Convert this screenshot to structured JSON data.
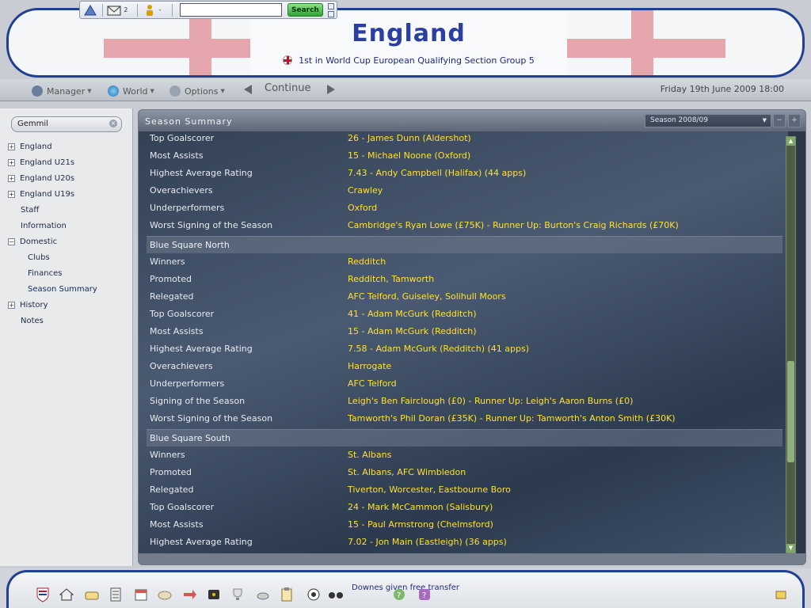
{
  "toolbar": {
    "mail_count": "2",
    "people_count": "-",
    "search_placeholder": "",
    "search_button": "Search"
  },
  "header": {
    "team_name": "England",
    "subtitle": "1st in World Cup European Qualifying Section Group 5"
  },
  "nav": {
    "manager": "Manager",
    "world": "World",
    "options": "Options",
    "continue": "Continue",
    "date": "Friday 19th June 2009 18:00"
  },
  "sidebar": {
    "search_value": "Gemmil",
    "items": [
      {
        "label": "England",
        "toggle": "+"
      },
      {
        "label": "England U21s",
        "toggle": "+"
      },
      {
        "label": "England U20s",
        "toggle": "+"
      },
      {
        "label": "England U19s",
        "toggle": "+"
      },
      {
        "label": "Staff",
        "toggle": ""
      },
      {
        "label": "Information",
        "toggle": ""
      },
      {
        "label": "Domestic",
        "toggle": "−"
      },
      {
        "label": "Clubs",
        "toggle": ""
      },
      {
        "label": "Finances",
        "toggle": ""
      },
      {
        "label": "Season Summary",
        "toggle": ""
      },
      {
        "label": "History",
        "toggle": "+"
      },
      {
        "label": "Notes",
        "toggle": ""
      }
    ]
  },
  "panel": {
    "title": "Season Summary",
    "season": "Season 2008/09",
    "sections": [
      {
        "title": "",
        "rows": [
          {
            "label": "Top Goalscorer",
            "value": "26 - James Dunn (Aldershot)"
          },
          {
            "label": "Most Assists",
            "value": "15 - Michael Noone (Oxford)"
          },
          {
            "label": "Highest Average Rating",
            "value": "7.43 - Andy Campbell (Halifax) (44 apps)"
          },
          {
            "label": "Overachievers",
            "value": "Crawley"
          },
          {
            "label": "Underperformers",
            "value": "Oxford"
          },
          {
            "label": "Worst Signing of the Season",
            "value": "Cambridge's Ryan Lowe (£75K) - Runner Up: Burton's Craig Richards (£70K)"
          }
        ]
      },
      {
        "title": "Blue Square North",
        "rows": [
          {
            "label": "Winners",
            "value": "Redditch"
          },
          {
            "label": "Promoted",
            "value": "Redditch, Tamworth"
          },
          {
            "label": "Relegated",
            "value": "AFC Telford, Guiseley, Solihull Moors"
          },
          {
            "label": "Top Goalscorer",
            "value": "41 - Adam McGurk (Redditch)"
          },
          {
            "label": "Most Assists",
            "value": "15 - Adam McGurk (Redditch)"
          },
          {
            "label": "Highest Average Rating",
            "value": "7.58 - Adam McGurk (Redditch) (41 apps)"
          },
          {
            "label": "Overachievers",
            "value": "Harrogate"
          },
          {
            "label": "Underperformers",
            "value": "AFC Telford"
          },
          {
            "label": "Signing of the Season",
            "value": "Leigh's Ben Fairclough (£0) - Runner Up: Leigh's Aaron Burns (£0)"
          },
          {
            "label": "Worst Signing of the Season",
            "value": "Tamworth's Phil Doran (£35K) - Runner Up: Tamworth's Anton Smith (£30K)"
          }
        ]
      },
      {
        "title": "Blue Square South",
        "rows": [
          {
            "label": "Winners",
            "value": "St. Albans"
          },
          {
            "label": "Promoted",
            "value": "St. Albans, AFC Wimbledon"
          },
          {
            "label": "Relegated",
            "value": "Tiverton, Worcester, Eastbourne Boro"
          },
          {
            "label": "Top Goalscorer",
            "value": "24 - Mark McCammon (Salisbury)"
          },
          {
            "label": "Most Assists",
            "value": "15 - Paul Armstrong (Chelmsford)"
          },
          {
            "label": "Highest Average Rating",
            "value": "7.02 - Jon Main (Eastleigh) (36 apps)"
          }
        ]
      }
    ]
  },
  "bottom": {
    "news": "Downes given free transfer"
  },
  "colors": {
    "value_text": "#ffe12e",
    "banner_border": "#1f3f95",
    "flag_red": "#e6a6ad"
  }
}
